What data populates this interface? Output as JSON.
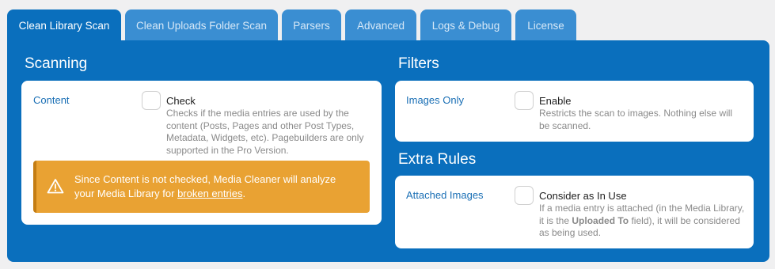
{
  "tabs": [
    {
      "label": "Clean Library Scan",
      "active": true
    },
    {
      "label": "Clean Uploads Folder Scan",
      "active": false
    },
    {
      "label": "Parsers",
      "active": false
    },
    {
      "label": "Advanced",
      "active": false
    },
    {
      "label": "Logs & Debug",
      "active": false
    },
    {
      "label": "License",
      "active": false
    }
  ],
  "scanning": {
    "title": "Scanning",
    "content": {
      "label": "Content",
      "checkbox_label": "Check",
      "checked": false,
      "description": "Checks if the media entries are used by the content (Posts, Pages and other Post Types, Metadata, Widgets, etc). Pagebuilders are only supported in the Pro Version."
    },
    "warning": {
      "icon": "warning-icon",
      "text_before": "Since Content is not checked, Media Cleaner will analyze your Media Library for ",
      "link_text": "broken entries",
      "text_after": "."
    }
  },
  "filters": {
    "title": "Filters",
    "images_only": {
      "label": "Images Only",
      "checkbox_label": "Enable",
      "checked": false,
      "description": "Restricts the scan to images. Nothing else will be scanned."
    }
  },
  "extra_rules": {
    "title": "Extra Rules",
    "attached_images": {
      "label": "Attached Images",
      "checkbox_label": "Consider as In Use",
      "checked": false,
      "desc_before": "If a media entry is attached (in the Media Library, it is the ",
      "desc_bold": "Uploaded To",
      "desc_after": " field), it will be considered as being used."
    }
  },
  "colors": {
    "panel": "#0a6fbd",
    "tab_inactive": "#3a8ed2",
    "warning": "#e9a233",
    "label": "#1a6fb5"
  }
}
